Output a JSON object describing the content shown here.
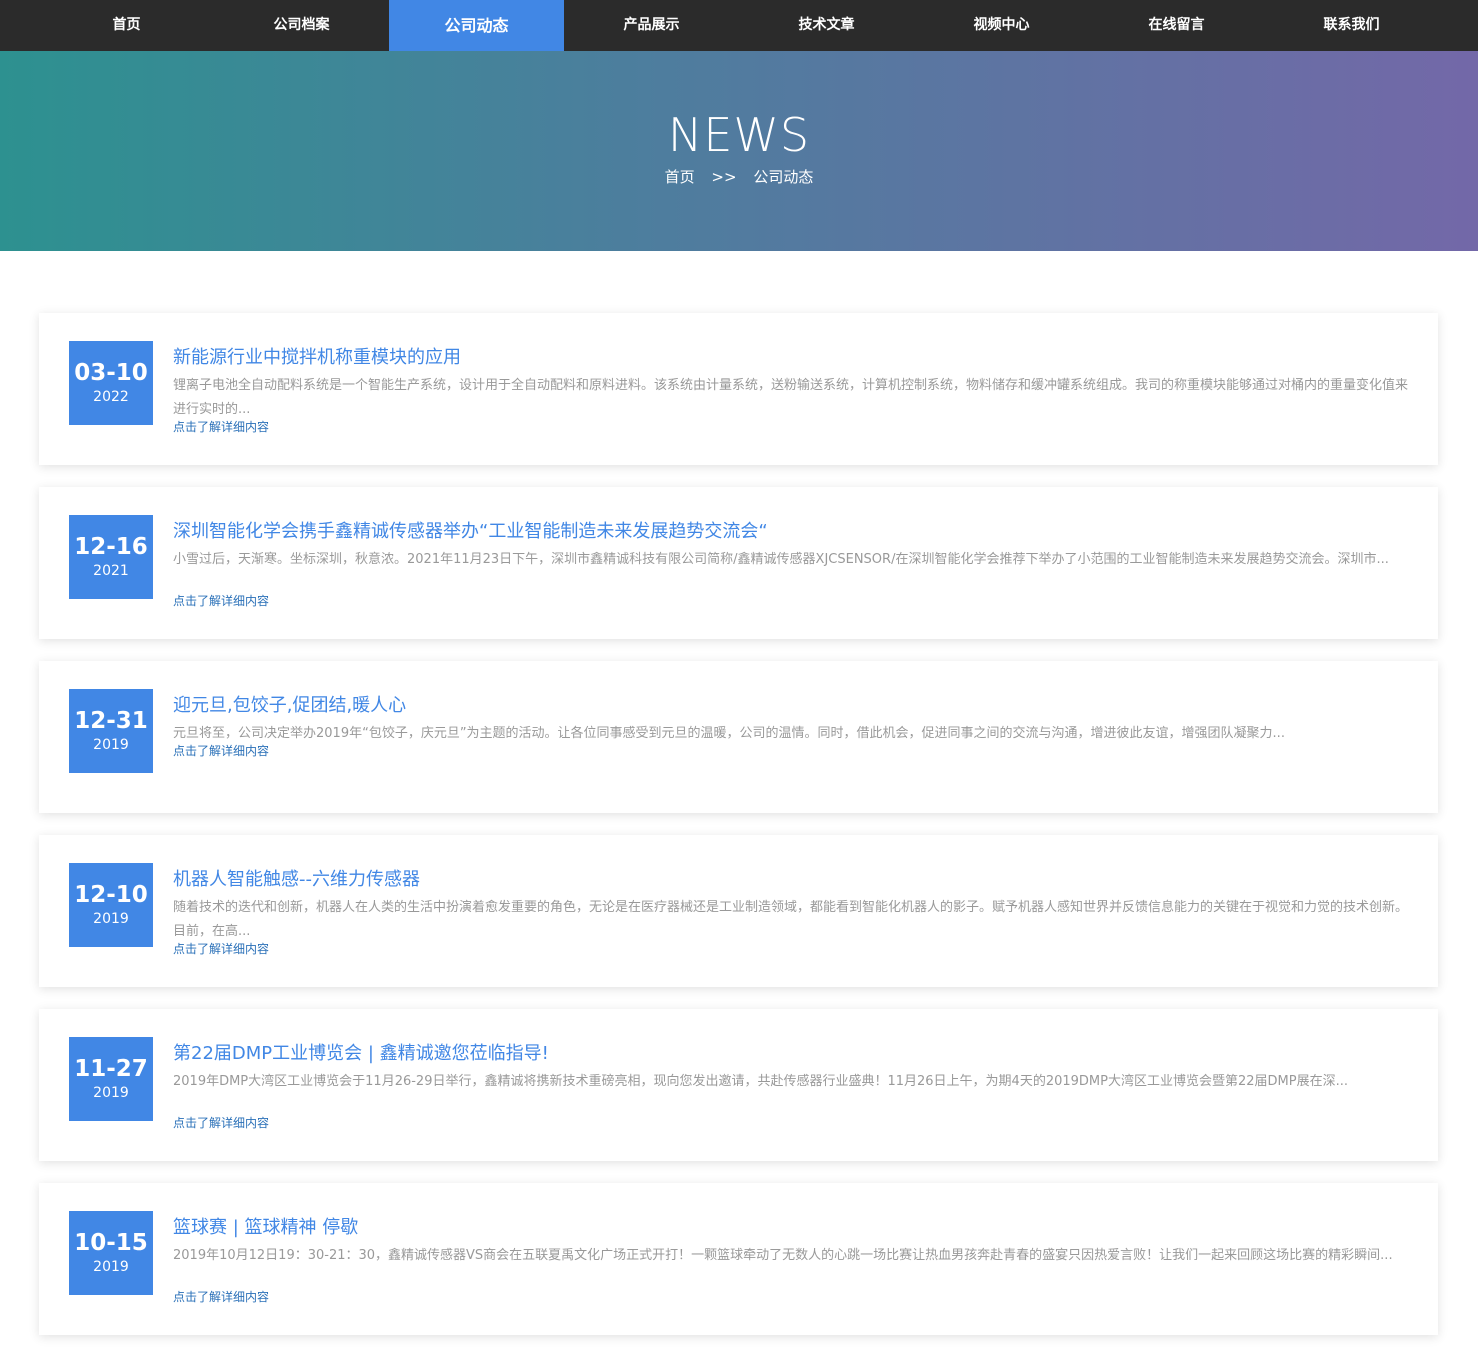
{
  "nav": {
    "items": [
      {
        "label": "首页"
      },
      {
        "label": "公司档案"
      },
      {
        "label": "公司动态"
      },
      {
        "label": "产品展示"
      },
      {
        "label": "技术文章"
      },
      {
        "label": "视频中心"
      },
      {
        "label": "在线留言"
      },
      {
        "label": "联系我们"
      }
    ],
    "active_label": "公司动态"
  },
  "banner": {
    "title": "NEWS",
    "breadcrumb": {
      "home": "首页",
      "separator": ">>",
      "current": "公司动态"
    }
  },
  "colors": {
    "accent": "#4187e5",
    "nav_bg": "#2b2b2b",
    "gradient_start": "#2d9190",
    "gradient_end": "#7368a8"
  },
  "news": [
    {
      "md": "03-10",
      "year": "2022",
      "title": "新能源行业中搅拌机称重模块的应用",
      "desc": "锂离子电池全自动配料系统是一个智能生产系统，设计用于全自动配料和原料进料。该系统由计量系统，送粉输送系统，计算机控制系统，物料储存和缓冲罐系统组成。我司的称重模块能够通过对桶内的重量变化值来进行实时的...",
      "more": "点击了解详细内容"
    },
    {
      "md": "12-16",
      "year": "2021",
      "title": "深圳智能化学会携手鑫精诚传感器举办“工业智能制造未来发展趋势交流会“",
      "desc": "小雪过后，天渐寒。坐标深圳，秋意浓。2021年11月23日下午，深圳市鑫精诚科技有限公司简称/鑫精诚传感器XJCSENSOR/在深圳智能化学会推荐下举办了小范围的工业智能制造未来发展趋势交流会。深圳市...",
      "more": "点击了解详细内容"
    },
    {
      "md": "12-31",
      "year": "2019",
      "title": "迎元旦,包饺子,促团结,暖人心",
      "desc": "元旦将至，公司决定举办2019年“包饺子，庆元旦”为主题的活动。让各位同事感受到元旦的温暖，公司的温情。同时，借此机会，促进同事之间的交流与沟通，增进彼此友谊，增强团队凝聚力...",
      "more": "点击了解详细内容"
    },
    {
      "md": "12-10",
      "year": "2019",
      "title": "机器人智能触感--六维力传感器",
      "desc": "随着技术的迭代和创新，机器人在人类的生活中扮演着愈发重要的角色，无论是在医疗器械还是工业制造领域，都能看到智能化机器人的影子。赋予机器人感知世界并反馈信息能力的关键在于视觉和力觉的技术创新。目前，在高...",
      "more": "点击了解详细内容"
    },
    {
      "md": "11-27",
      "year": "2019",
      "title": "第22届DMP工业博览会 | 鑫精诚邀您莅临指导!",
      "desc": "2019年DMP大湾区工业博览会于11月26-29日举行，鑫精诚将携新技术重磅亮相，现向您发出邀请，共赴传感器行业盛典！11月26日上午，为期4天的2019DMP大湾区工业博览会暨第22届DMP展在深...",
      "more": "点击了解详细内容"
    },
    {
      "md": "10-15",
      "year": "2019",
      "title": "篮球赛 | 篮球精神 停歇",
      "desc": "2019年10月12日19：30-21：30，鑫精诚传感器VS商会在五联夏禹文化广场正式开打！一颗篮球牵动了无数人的心跳一场比赛让热血男孩奔赴青春的盛宴只因热爱言败！让我们一起来回顾这场比赛的精彩瞬间...",
      "more": "点击了解详细内容"
    }
  ]
}
